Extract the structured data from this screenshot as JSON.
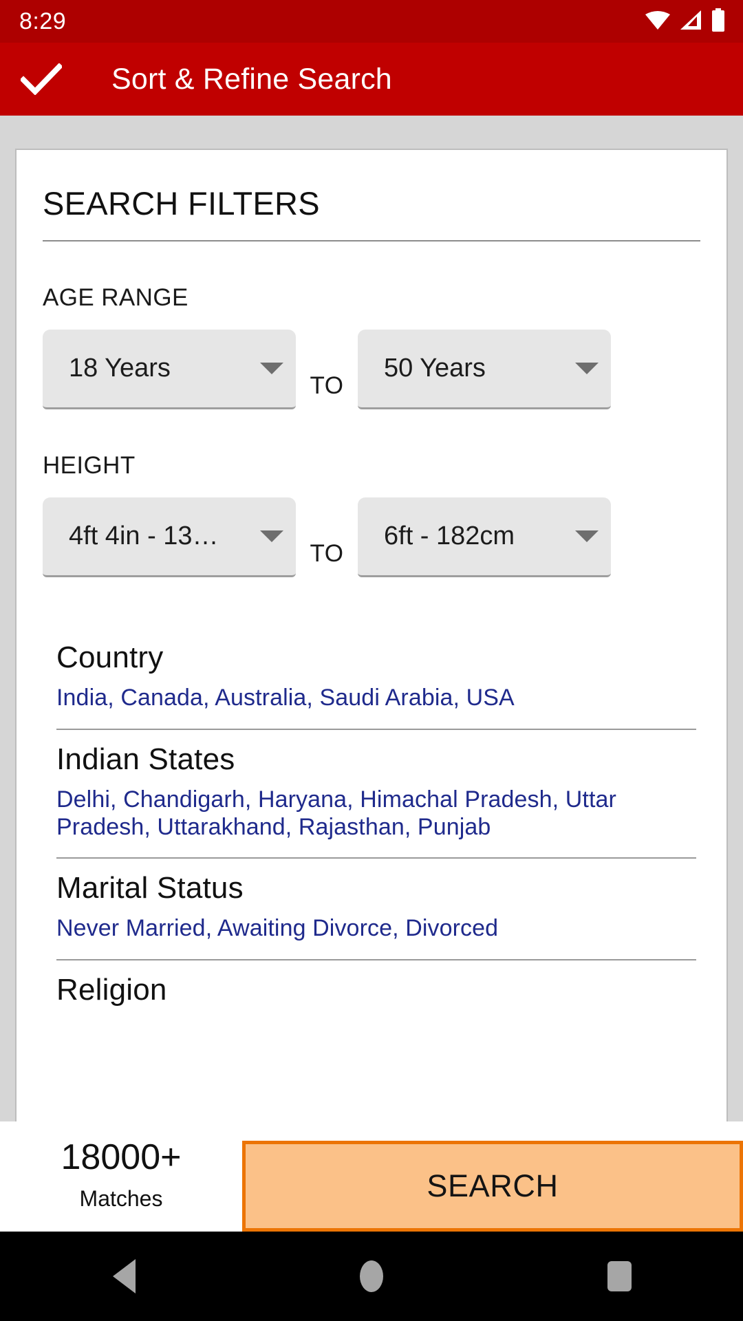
{
  "statusbar": {
    "time": "8:29",
    "icons": [
      "wifi-icon",
      "cellular-signal-icon",
      "battery-icon"
    ]
  },
  "appbar": {
    "confirm_icon": "check-icon",
    "title": "Sort & Refine Search",
    "background_color": "#c00000",
    "text_color": "#ffffff"
  },
  "card": {
    "title": "SEARCH FILTERS",
    "age_range": {
      "label": "AGE RANGE",
      "from_value": "18 Years",
      "to_separator": "TO",
      "to_value": "50 Years"
    },
    "height_range": {
      "label": "HEIGHT",
      "from_value": "4ft 4in - 13…",
      "to_separator": "TO",
      "to_value": "6ft - 182cm"
    },
    "filters": [
      {
        "name": "Country",
        "value": "India, Canada, Australia, Saudi Arabia, USA"
      },
      {
        "name": "Indian States",
        "value": "Delhi, Chandigarh, Haryana, Himachal Pradesh, Uttar Pradesh, Uttarakhand, Rajasthan, Punjab"
      },
      {
        "name": "Marital Status",
        "value": "Never Married, Awaiting Divorce, Divorced"
      },
      {
        "name": "Religion",
        "value": ""
      }
    ],
    "value_color": "#1f2a8c"
  },
  "bottombar": {
    "matches_count": "18000+",
    "matches_label": "Matches",
    "search_label": "SEARCH",
    "search_fill": "#fbc188",
    "search_border": "#ec7404"
  },
  "navbar": {
    "back": "back-triangle-icon",
    "home": "home-circle-icon",
    "recents": "recents-square-icon"
  }
}
